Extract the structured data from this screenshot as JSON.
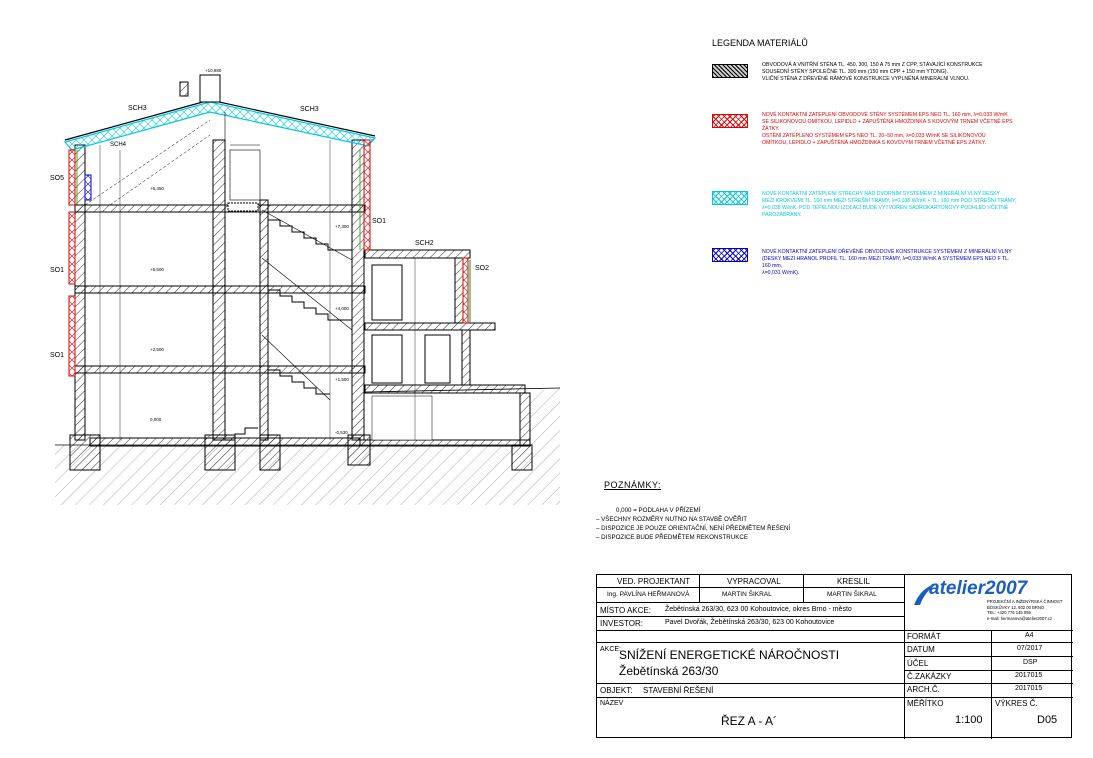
{
  "legend": {
    "title": "LEGENDA MATERIÁLŮ",
    "items": [
      {
        "text": "OBVODOVÁ A VNITŘNÍ STĚNA TL. 450, 300, 150 A 75 mm Z CPP, STÁVAJÍCÍ KONSTRUKCE\nSOUSEDNÍ STĚNY SPOLEČNÉ TL. 300 mm (150 mm CPP + 150 mm YTONG).\nVLIČNÍ STĚNA Z DŘEVĚNÉ RÁMOVÉ KONSTRUKCE VYPLNĚNÁ MINERÁLNÍ VLNOU.",
        "color": "#000000"
      },
      {
        "text": "NOVÉ KONTAKTNÍ ZATEPLENÍ OBVODOVÉ STĚNY SYSTÉMEM EPS NEO TL. 160 mm, λ=0,033 W/mK\nSE SILIKONOVOU OMÍTKOU, LEPIDLO + ZAPUŠTĚNÁ HMOŽDINKA S KOVOVÝM TRNEM VČETNĚ EPS\nŽÁTKY.\nOSTĚNÍ ZATEPLENO SYSTÉMEM EPS NEO TL. 20–50 mm, λ=0,033 W/mK SE SILIKONOVOU\nOMÍTKOU, LEPIDLO + ZAPUŠTĚNÁ HMOŽDINKA S KOVOVÝM TRNEM VČETNĚ EPS ZÁTKY.",
        "color": "#e00000"
      },
      {
        "text": "NOVÉ KONTAKTNÍ ZATEPLENÍ STŘECHY NAD DVORNÍM SYSTÉMEM Z MINERÁLNÍ VLNY DESKY\nMEZI KROKVEMI TL. 160 mm MEZI STŘEŠNÍ TRÁMY, λ=0,038 W/mK + TL. 160 mm POD STŘEŠNÍ TRÁMY,\nλ=0,038 W/mK, POD TEPELNOU IZOLACÍ BUDE VYTVOŘEN SÁDROKARTONOVÝ PODHLED VČETNĚ\nPAROZÁBRANY.",
        "color": "#00c8e0"
      },
      {
        "text": "NOVÉ KONTAKTNÍ ZATEPLENÍ DŘEVĚNÉ OBVODOVÉ KONSTRUKCE SYSTÉMEM Z MINERÁLNÍ VLNY\n(DESKY MEZI HRANOL PROFIL TL. 160 mm MEZI TRÁMY, λ=0,033 W/mK A SYSTÉMEM EPS NEO F TL. 160 mm,\nλ=0,031 W/mK).",
        "color": "#0000cc"
      }
    ]
  },
  "section_labels": {
    "sch3_left": "SCH3",
    "sch3_right": "SCH3",
    "sch4": "SCH4",
    "sch2": "SCH2",
    "so5": "SO5",
    "so1_a": "SO1",
    "so1_b": "SO1",
    "so1_c": "SO1",
    "so1_d": "SO1",
    "so2": "SO2",
    "lvl_top": "+10,880",
    "lvl_attic": "+6,450",
    "lvl_2": "+5,500",
    "lvl_stair": "+7,300",
    "lvl_1": "+2,500",
    "lvl_mid": "+4,000",
    "lvl_0": "+1,500",
    "lvl_base": "0,000",
    "lvl_ground": "-0,530"
  },
  "notes": {
    "title": "POZNÁMKY:",
    "lines": [
      "0,000 = PODLAHA V PŘÍZEMÍ",
      "– VŠECHNY ROZMĚRY NUTNO NA STAVBĚ OVĚŘIT",
      "– DISPOZICE JE POUZE ORIENTAČNÍ, NENÍ PŘEDMĚTEM ŘEŠENÍ",
      "– DISPOZICE BUDE PŘEDMĚTEM REKONSTRUKCE"
    ]
  },
  "title_block": {
    "ved_projektant_h": "VED. PROJEKTANT",
    "ved_projektant": "Ing. PAVLÍNA HEŘMANOVÁ",
    "vypracoval_h": "VYPRACOVAL",
    "vypracoval": "MARTIN ŠIKRAL",
    "kreslil_h": "KRESLIL",
    "kreslil": "MARTIN ŠIKRAL",
    "logo": "atelier2007",
    "logo_sub": "PROJEKČNÍ A INŽENÝRSKÁ ČINNOST\nBOSKŮVKY 12, 602 00 BRNO\nTEL: +420 776 145 055\ne-mail: hermanova@atelier2007.cz",
    "misto_h": "MÍSTO AKCE:",
    "misto": "Žebětínská 263/30, 623 00 Kohoutovice, okres Brno - město",
    "investor_h": "INVESTOR:",
    "investor": "Pavel Dvořák, Žebětínská 263/30, 623 00 Kohoutovice",
    "akce_h": "AKCE:",
    "akce": "SNÍŽENÍ ENERGETICKÉ NÁROČNOSTI",
    "akce2": "Žebětínská 263/30",
    "objekt_h": "OBJEKT:",
    "objekt": "STAVEBNÍ ŘEŠENÍ",
    "nazev_h": "NÁZEV",
    "nazev": "ŘEZ A - A´",
    "format_h": "FORMÁT",
    "format": "A4",
    "datum_h": "DATUM",
    "datum": "07/2017",
    "ucel_h": "ÚČEL",
    "ucel": "DSP",
    "zakazky_h": "Č.ZAKÁZKY",
    "zakazky": "2017015",
    "arch_h": "ARCH.Č.",
    "arch": "2017015",
    "meritko_h": "MĚŘÍTKO",
    "meritko": "1:100",
    "vykres_h": "VÝKRES Č.",
    "vykres": "D05"
  },
  "colors": {
    "red": "#e00000",
    "cyan": "#00c8e0",
    "blue": "#0000cc",
    "green": "#00a000",
    "logo": "#1a5fc0"
  }
}
